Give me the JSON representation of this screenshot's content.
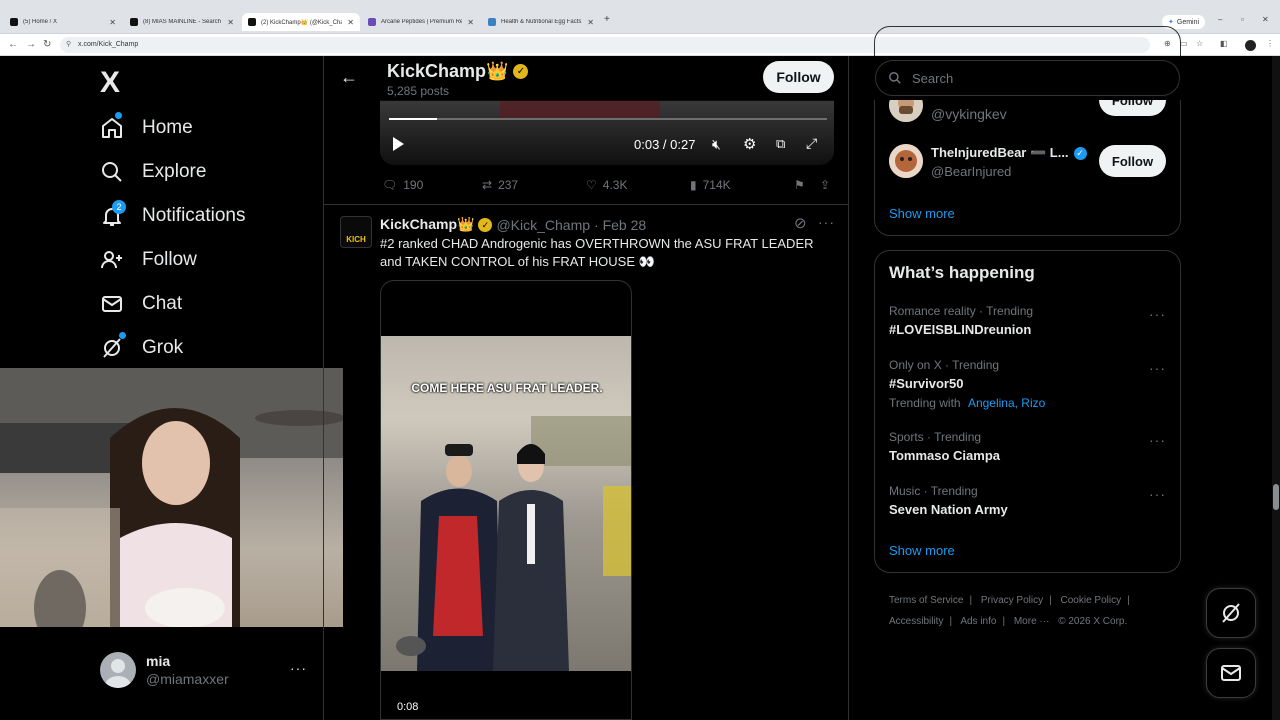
{
  "browser": {
    "tabs": [
      {
        "label": "(5) Home / X"
      },
      {
        "label": "(8) MIAS MAINLINE - Search / X"
      },
      {
        "label": "(2) KickChamp👑 (@Kick_Cha..."
      },
      {
        "label": "Arcane Peptides | Premium Res..."
      },
      {
        "label": "Health & Nutritional Egg Facts"
      }
    ],
    "gemini_label": "Gemini",
    "url": "x.com/Kick_Champ"
  },
  "sidebar": {
    "logo": "X",
    "items": [
      {
        "label": "Home"
      },
      {
        "label": "Explore"
      },
      {
        "label": "Notifications",
        "badge": "2"
      },
      {
        "label": "Follow"
      },
      {
        "label": "Chat"
      },
      {
        "label": "Grok"
      }
    ],
    "account": {
      "name": "mia",
      "handle": "@miamaxxer"
    }
  },
  "header": {
    "name": "KickChamp👑",
    "posts": "5,285 posts",
    "follow_label": "Follow"
  },
  "video1": {
    "time": "0:03 / 0:27",
    "progress": 0.11,
    "stats": {
      "replies": "190",
      "reposts": "237",
      "likes": "4.3K",
      "views": "714K"
    }
  },
  "post2": {
    "name": "KickChamp👑",
    "handle": "@Kick_Champ",
    "date": "· Feb 28",
    "avatar_text": "KICH",
    "text": "#2 ranked CHAD Androgenic has OVERTHROWN the ASU FRAT LEADER and TAKEN CONTROL of his FRAT HOUSE 👀",
    "video_caption": "COME HERE ASU FRAT LEADER.",
    "video_time": "0:08"
  },
  "right": {
    "search_placeholder": "Search",
    "who_to_follow": [
      {
        "name": "",
        "handle": "@vykingkev",
        "button": "Follow"
      },
      {
        "name": "TheInjuredBear ➖ L...",
        "handle": "@BearInjured",
        "button": "Follow"
      }
    ],
    "show_more": "Show more",
    "happening_title": "What’s happening",
    "trends": [
      {
        "meta": "Romance reality · Trending",
        "title": "#LOVEISBLINDreunion"
      },
      {
        "meta": "Only on X · Trending",
        "title": "#Survivor50",
        "with_label": "Trending with",
        "with_links": "Angelina, Rizo"
      },
      {
        "meta": "Sports · Trending",
        "title": "Tommaso Ciampa"
      },
      {
        "meta": "Music · Trending",
        "title": "Seven Nation Army"
      }
    ],
    "show_more2": "Show more",
    "footer": {
      "terms": "Terms of Service",
      "privacy": "Privacy Policy",
      "cookie": "Cookie Policy",
      "accessibility": "Accessibility",
      "ads": "Ads info",
      "more": "More ···",
      "copyright": "© 2026 X Corp."
    }
  },
  "colors": {
    "accent": "#1d9bf0",
    "bg": "#000000",
    "border": "#2f3336",
    "muted": "#71767b"
  }
}
